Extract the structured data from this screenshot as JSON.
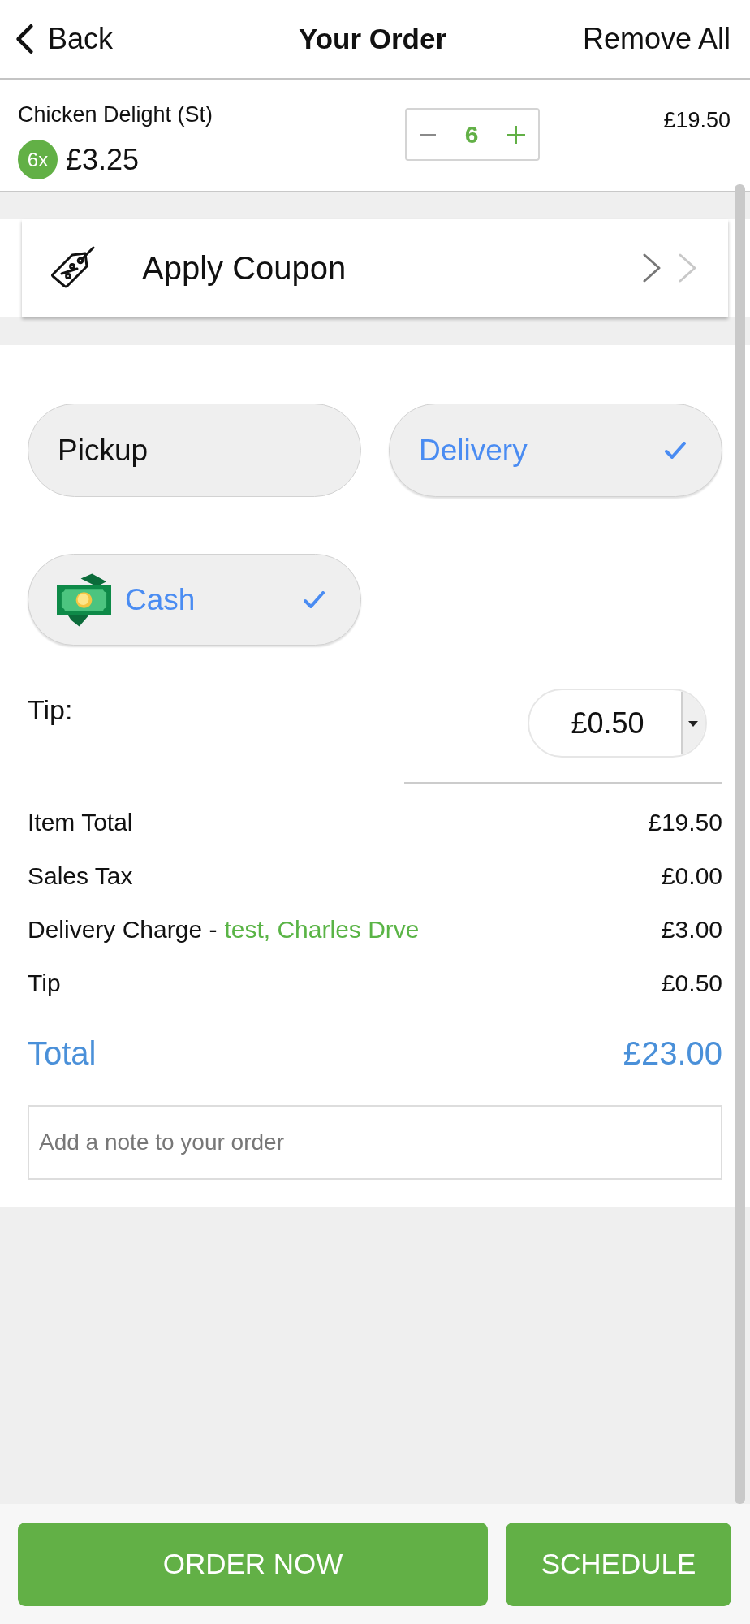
{
  "header": {
    "back_label": "Back",
    "title": "Your Order",
    "remove_all_label": "Remove All"
  },
  "cart_items": [
    {
      "name": "Chicken Delight (St)",
      "quantity_badge": "6x",
      "unit_price": "£3.25",
      "quantity": "6",
      "line_total": "£19.50"
    }
  ],
  "coupon": {
    "label": "Apply Coupon"
  },
  "fulfillment_options": [
    {
      "label": "Pickup",
      "selected": false
    },
    {
      "label": "Delivery",
      "selected": true
    }
  ],
  "payment_options": [
    {
      "kind": "cash",
      "label": "Cash",
      "selected": true
    }
  ],
  "tip": {
    "label": "Tip:",
    "value": "£0.50"
  },
  "summary": [
    {
      "label": "Item Total",
      "value": "£19.50"
    },
    {
      "label": "Sales Tax",
      "value": "£0.00"
    },
    {
      "label": "Delivery Charge -",
      "detail": "test, Charles Drve",
      "value": "£3.00"
    },
    {
      "label": "Tip",
      "value": "£0.50"
    }
  ],
  "total": {
    "label": "Total",
    "value": "£23.00"
  },
  "note": {
    "placeholder": "Add a note to your order"
  },
  "actions": [
    {
      "kind": "order",
      "label": "ORDER NOW"
    },
    {
      "kind": "schedule",
      "label": "SCHEDULE"
    }
  ]
}
